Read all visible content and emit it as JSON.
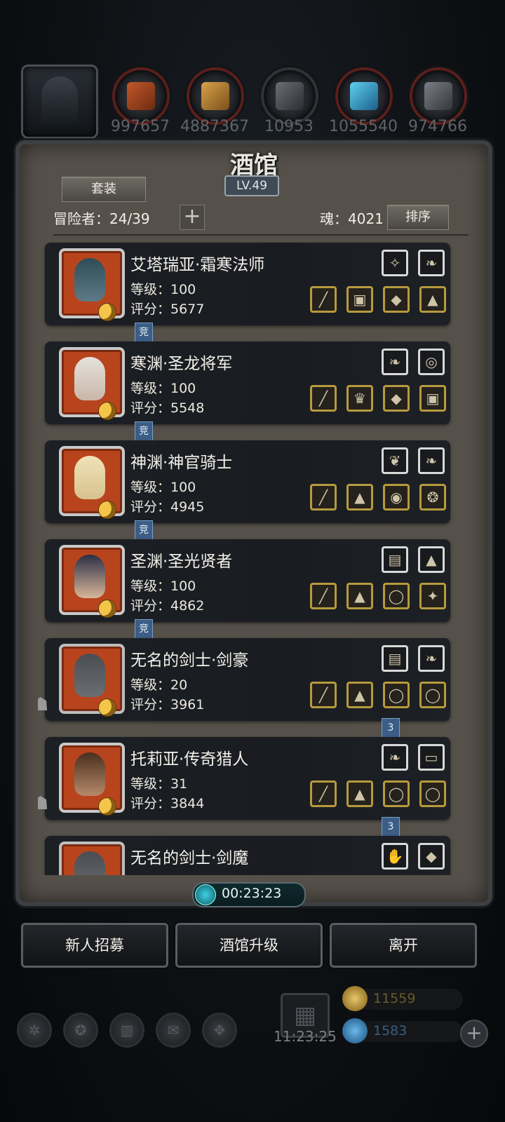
{
  "resources": [
    {
      "value": "997657",
      "icon": "ore-icon"
    },
    {
      "value": "4887367",
      "icon": "wood-icon"
    },
    {
      "value": "10953",
      "icon": "stone-icon"
    },
    {
      "value": "1055540",
      "icon": "crystal-icon"
    },
    {
      "value": "974766",
      "icon": "iron-icon"
    }
  ],
  "panel": {
    "title": "酒馆",
    "level": "LV.49",
    "outfit_label": "套装",
    "adventurers_label": "冒险者：24/39",
    "soul_label": "魂：4021",
    "sort_label": "排序"
  },
  "heroes": [
    {
      "name": "艾塔瑞亚·霜寒法师",
      "level": "等级：100",
      "score": "评分：5677",
      "tag": "竞",
      "skin": "#5d7a86"
    },
    {
      "name": "寒渊·圣龙将军",
      "level": "等级：100",
      "score": "评分：5548",
      "tag": "竞",
      "skin": "#c9b7a9"
    },
    {
      "name": "神渊·神官骑士",
      "level": "等级：100",
      "score": "评分：4945",
      "tag": "竞",
      "skin": "#d7c28e"
    },
    {
      "name": "圣渊·圣光贤者",
      "level": "等级：100",
      "score": "评分：4862",
      "tag": "竞",
      "skin": "#d9b79a"
    },
    {
      "name": "无名的剑士·剑豪",
      "level": "等级：20",
      "score": "评分：3961",
      "tag": "3",
      "skin": "#6b6e72"
    },
    {
      "name": "托莉亚·传奇猎人",
      "level": "等级：31",
      "score": "评分：3844",
      "tag": "3",
      "skin": "#b58a6a"
    },
    {
      "name": "无名的剑士·剑魔",
      "level": "",
      "score": "",
      "tag": "",
      "skin": "#6b6e72"
    }
  ],
  "timer": "00:23:23",
  "buttons": {
    "recruit": "新人招募",
    "upgrade": "酒馆升级",
    "leave": "离开"
  },
  "gift_timer": "11:23:25",
  "currency": {
    "gold": "11559",
    "gem": "1583"
  },
  "colors": {
    "panel_bg": "#555049",
    "card_bg": "#1c1f24",
    "gold_frame": "#b69a3d",
    "tag_blue": "#3b5d86"
  }
}
